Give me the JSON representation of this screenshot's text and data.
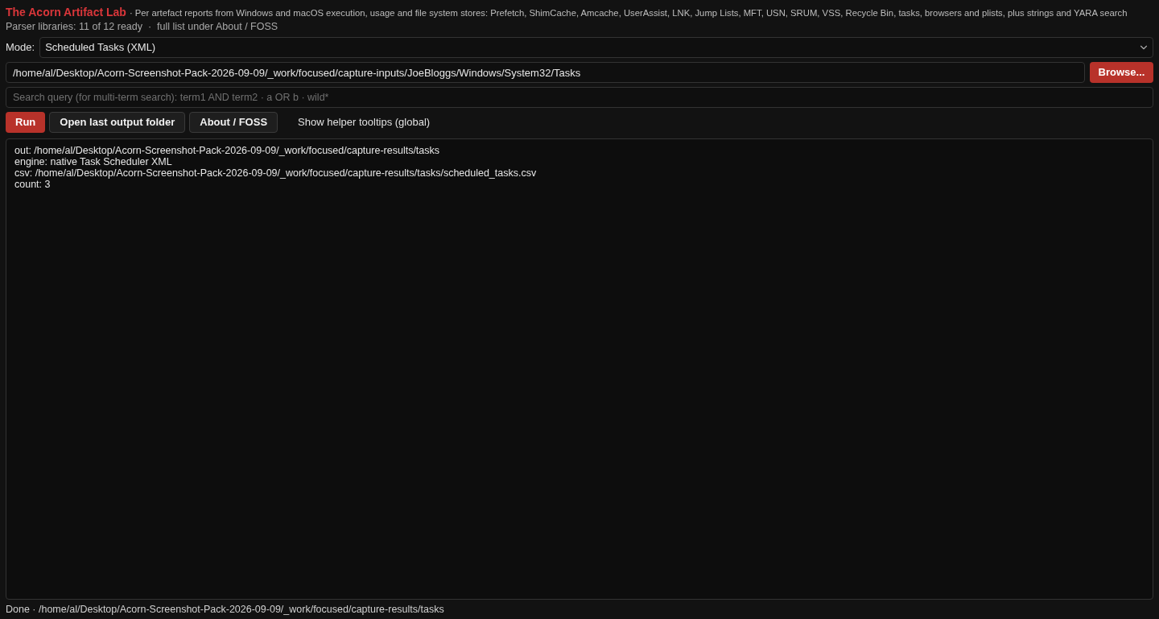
{
  "header": {
    "title": "The Acorn Artifact Lab",
    "subtitle": "· Per artefact reports from Windows and macOS execution, usage and file system stores: Prefetch, ShimCache, Amcache, UserAssist, LNK, Jump Lists, MFT, USN, SRUM, VSS, Recycle Bin, tasks, browsers and plists, plus strings and YARA search",
    "status": "Parser libraries: 11 of 12 ready  ·  full list under About / FOSS"
  },
  "mode": {
    "label": "Mode:",
    "value": "Scheduled Tasks (XML)"
  },
  "path": {
    "value": "/home/al/Desktop/Acorn-Screenshot-Pack-2026-09-09/_work/focused/capture-inputs/JoeBloggs/Windows/System32/Tasks",
    "button": "Browse..."
  },
  "search": {
    "placeholder": "Search query (for multi-term search): term1 AND term2 · a OR b · wild*"
  },
  "actions": [
    {
      "label": "Run",
      "kind": "primary"
    },
    {
      "label": "Open last output folder",
      "kind": "secondary"
    },
    {
      "label": "About / FOSS",
      "kind": "secondary"
    },
    {
      "label": "Show helper tooltips (global)",
      "kind": "plain"
    }
  ],
  "output": {
    "lines": [
      "out: /home/al/Desktop/Acorn-Screenshot-Pack-2026-09-09/_work/focused/capture-results/tasks",
      "engine: native Task Scheduler XML",
      "csv: /home/al/Desktop/Acorn-Screenshot-Pack-2026-09-09/_work/focused/capture-results/tasks/scheduled_tasks.csv",
      "count: 3"
    ]
  },
  "status_bar": {
    "text": "Done · /home/al/Desktop/Acorn-Screenshot-Pack-2026-09-09/_work/focused/capture-results/tasks"
  }
}
